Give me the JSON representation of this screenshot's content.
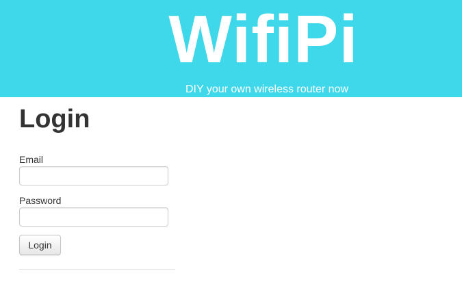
{
  "banner": {
    "title": "WifiPi",
    "subtitle": "DIY your own wireless router now",
    "color": "#3ed8ea"
  },
  "login": {
    "title": "Login",
    "email_label": "Email",
    "email_value": "",
    "password_label": "Password",
    "password_value": "",
    "button_label": "Login"
  }
}
